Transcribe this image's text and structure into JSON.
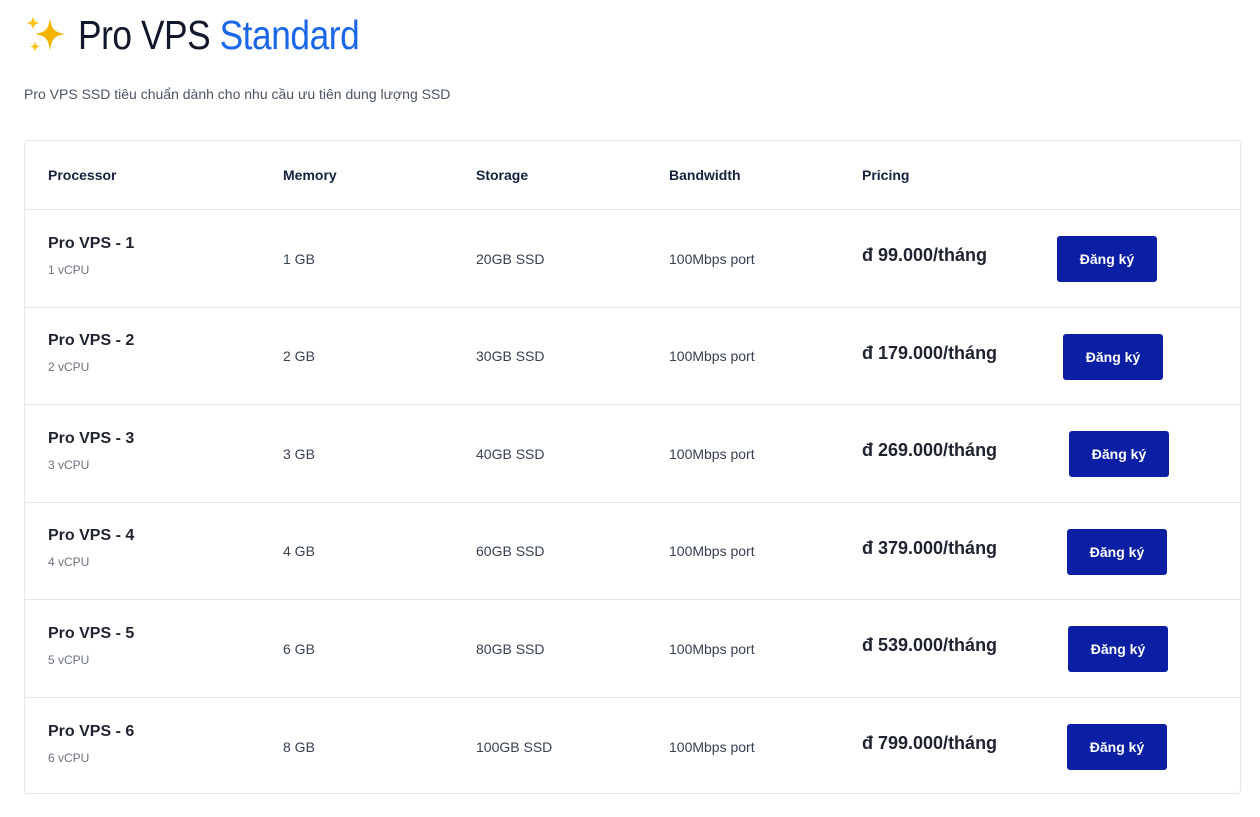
{
  "header": {
    "icon": "sparkle-icon",
    "title_main": "Pro VPS ",
    "title_accent": "Standard",
    "subtitle": "Pro VPS SSD tiêu chuẩn dành cho nhu cầu ưu tiên dung lượng SSD"
  },
  "colors": {
    "accent": "#1a66e8",
    "button": "#0a1fa3",
    "sparkle": "#f5b800"
  },
  "table": {
    "headers": {
      "processor": "Processor",
      "memory": "Memory",
      "storage": "Storage",
      "bandwidth": "Bandwidth",
      "pricing": "Pricing"
    },
    "rows": [
      {
        "name": "Pro VPS - 1",
        "cpu": "1 vCPU",
        "memory": "1 GB",
        "storage": "20GB SSD",
        "bandwidth": "100Mbps port",
        "price": "đ 99.000/tháng",
        "button": "Đăng ký"
      },
      {
        "name": "Pro VPS - 2",
        "cpu": "2 vCPU",
        "memory": "2 GB",
        "storage": "30GB SSD",
        "bandwidth": "100Mbps port",
        "price": "đ 179.000/tháng",
        "button": "Đăng ký"
      },
      {
        "name": "Pro VPS - 3",
        "cpu": "3 vCPU",
        "memory": "3 GB",
        "storage": "40GB SSD",
        "bandwidth": "100Mbps port",
        "price": "đ 269.000/tháng",
        "button": "Đăng ký"
      },
      {
        "name": "Pro VPS - 4",
        "cpu": "4 vCPU",
        "memory": "4 GB",
        "storage": "60GB SSD",
        "bandwidth": "100Mbps port",
        "price": "đ 379.000/tháng",
        "button": "Đăng ký"
      },
      {
        "name": "Pro VPS - 5",
        "cpu": "5 vCPU",
        "memory": "6 GB",
        "storage": "80GB SSD",
        "bandwidth": "100Mbps port",
        "price": "đ 539.000/tháng",
        "button": "Đăng ký"
      },
      {
        "name": "Pro VPS - 6",
        "cpu": "6 vCPU",
        "memory": "8 GB",
        "storage": "100GB SSD",
        "bandwidth": "100Mbps port",
        "price": "đ 799.000/tháng",
        "button": "Đăng ký"
      }
    ]
  }
}
